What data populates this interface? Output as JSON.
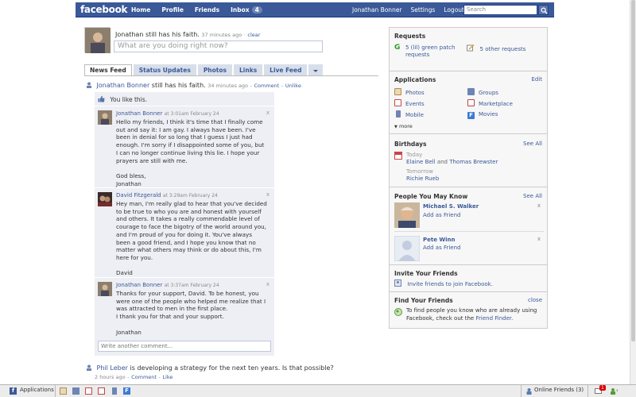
{
  "topbar": {
    "logo": "facebook",
    "nav": {
      "home": "Home",
      "profile": "Profile",
      "friends": "Friends",
      "inbox": "Inbox",
      "inbox_count": "4"
    },
    "right": {
      "user": "Jonathan Bonner",
      "settings": "Settings",
      "logout": "Logout"
    },
    "search_placeholder": "Search"
  },
  "composer": {
    "status_name": "Jonathan",
    "status_text": "still has his faith.",
    "status_time": "37 minutes ago",
    "clear": "clear",
    "placeholder": "What are you doing right now?"
  },
  "tabs": [
    "News Feed",
    "Status Updates",
    "Photos",
    "Links",
    "Live Feed"
  ],
  "feed": {
    "story1": {
      "name": "Jonathan Bonner",
      "text": "still has his faith.",
      "time": "34 minutes ago",
      "comment": "Comment",
      "unlike": "Unlike"
    },
    "like_text": "You like this.",
    "comments": [
      {
        "name": "Jonathan Bonner",
        "time": "at 3:01am February 24",
        "body": "Hello my friends, I think it's time that I finally come\nout and say it: I am gay. I always have been. I've\nbeen in denial for so long that I guess I just had\nenough. I'm sorry if I disappointed some of you, but\nI can no longer continue living this lie. I hope your\nprayers are still with me.\n\nGod bless,\nJonathan"
      },
      {
        "name": "David Fitzgerald",
        "time": "at 3:29am February 24",
        "body": "Hey man, I'm really glad to hear that you've decided\nto be true to who you are and honest with yourself\nand others. It takes a really commendable level of\ncourage to face the bigotry of the world around you,\nand I'm proud of you for doing it. You've always\nbeen a good friend, and I hope you know that no\nmatter what others may think or do about this, I'm\nhere for you.\n\nDavid"
      },
      {
        "name": "Jonathan Bonner",
        "time": "at 3:37am February 24",
        "body": "Thanks for your support, David. To be honest, you\nwere one of the people who helped me realize that I\nwas attracted to men in the first place.\nI thank you for that and your support.\n\nJonathan"
      }
    ],
    "write_placeholder": "Write another comment...",
    "story2": {
      "name": "Phil Leber",
      "text": "is developing a strategy for the next ten years. Is that possible?",
      "time": "2 hours ago",
      "comment": "Comment",
      "like": "Like"
    }
  },
  "right": {
    "requests": {
      "title": "Requests",
      "green_patch": "5 (lil) green patch requests",
      "other": "5 other requests"
    },
    "applications": {
      "title": "Applications",
      "edit": "Edit",
      "items": [
        "Photos",
        "Groups",
        "Events",
        "Marketplace",
        "Mobile",
        "Movies"
      ],
      "more": "more"
    },
    "birthdays": {
      "title": "Birthdays",
      "see_all": "See All",
      "today": "Today",
      "today_names": {
        "a": "Elaine Bell",
        "and": "and",
        "b": "Thomas Brewster"
      },
      "tomorrow": "Tomorrow",
      "tomorrow_name": "Richie Rueb"
    },
    "pymk": {
      "title": "People You May Know",
      "see_all": "See All",
      "people": [
        {
          "name": "Michael S. Walker",
          "add": "Add as Friend"
        },
        {
          "name": "Pete Winn",
          "add": "Add as Friend"
        }
      ]
    },
    "invite": {
      "title": "Invite Your Friends",
      "link": "Invite friends to join Facebook."
    },
    "find": {
      "title": "Find Your Friends",
      "close": "close",
      "text": "To find people you know who are already using Facebook, check out the",
      "link": "Friend Finder."
    }
  },
  "bottombar": {
    "applications": "Applications",
    "online": "Online Friends",
    "online_count": "(3)",
    "notif_count": "1"
  },
  "colors": {
    "brand": "#3b5998",
    "comment_bg": "#edeff4",
    "tab_bg": "#d8dfea"
  }
}
